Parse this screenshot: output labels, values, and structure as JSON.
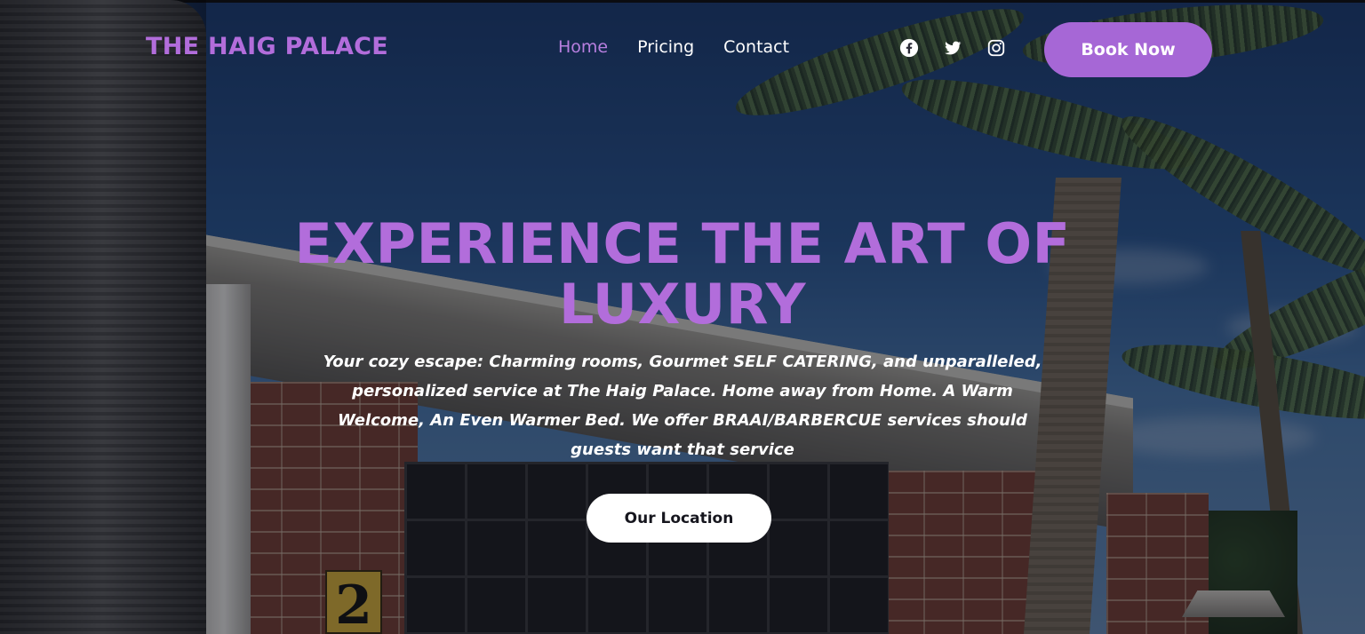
{
  "brand": {
    "name": "THE HAIG PALACE",
    "color": "#b26ddb"
  },
  "nav": {
    "items": [
      {
        "label": "Home",
        "active": true
      },
      {
        "label": "Pricing",
        "active": false
      },
      {
        "label": "Contact",
        "active": false
      }
    ],
    "active_color": "#b77fdf"
  },
  "socials": [
    {
      "icon": "facebook-icon"
    },
    {
      "icon": "twitter-icon"
    },
    {
      "icon": "instagram-icon"
    }
  ],
  "cta": {
    "book_label": "Book Now",
    "book_color": "#a667d6"
  },
  "hero": {
    "headline": "EXPERIENCE THE ART OF LUXURY",
    "description": "Your cozy escape: Charming rooms, Gourmet SELF CATERING, and unparalleled, personalized service at The Haig Palace. Home away from Home. A Warm Welcome, An Even Warmer Bed. We offer BRAAI/BARBERCUE services should guests want that service",
    "location_label": "Our Location",
    "house_number": "2",
    "background": "photo-house-entrance-with-palm-trees"
  }
}
